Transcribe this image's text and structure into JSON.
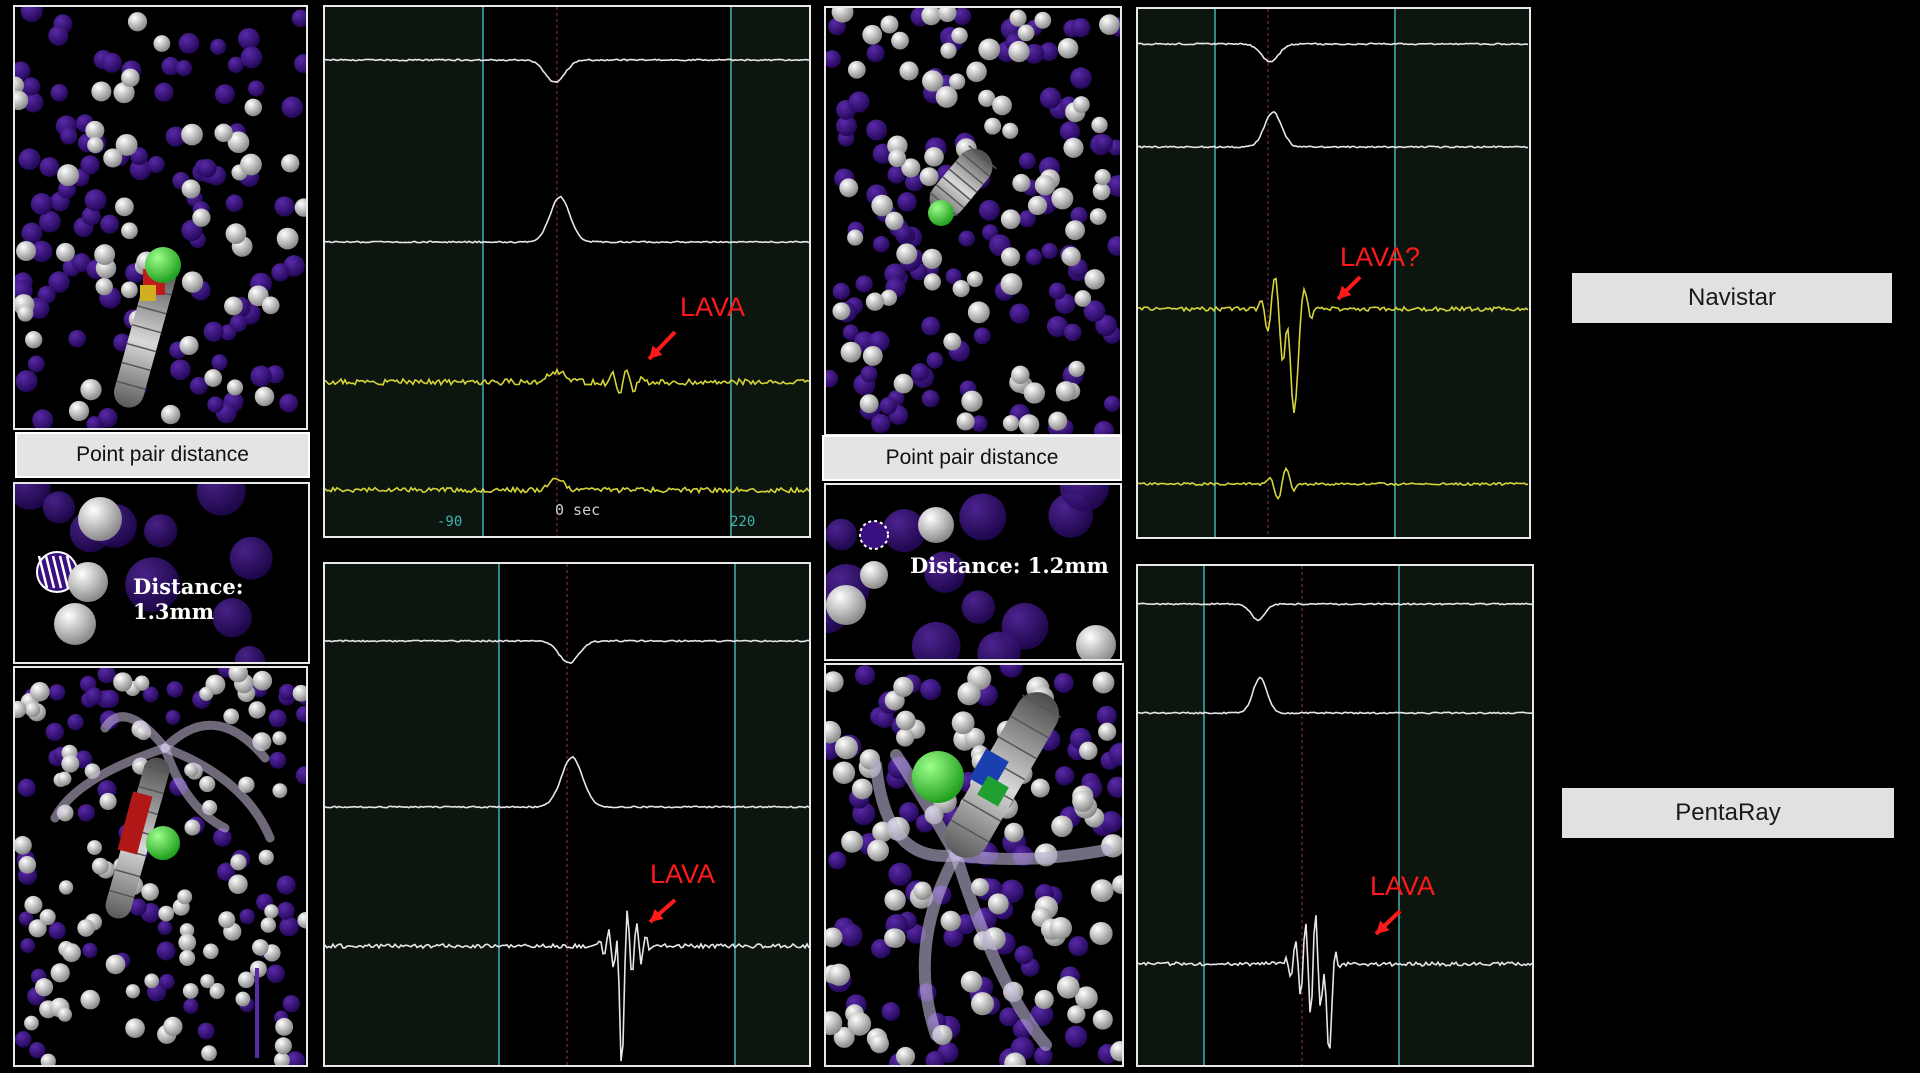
{
  "labels": {
    "point_pair_distance": "Point pair distance",
    "distance_navistar": "Distance: 1.3mm",
    "distance_pentaray": "Distance: 1.2mm",
    "navistar": "Navistar",
    "pentaray": "PentaRay",
    "lava": "LAVA",
    "lava_question": "LAVA?"
  },
  "egm_axis": {
    "left_tick": "-90",
    "center_tick": "0 sec",
    "right_tick": "220"
  },
  "colors": {
    "background": "#000000",
    "egm_background": "#0d150f",
    "trace_white": "#e6e6e6",
    "trace_yellow": "#d4d43a",
    "window_line": "#3fb2b2",
    "annotation_red": "#ff1a1a",
    "point_purple": "#3a1080",
    "point_white": "#e8e8e8"
  }
}
